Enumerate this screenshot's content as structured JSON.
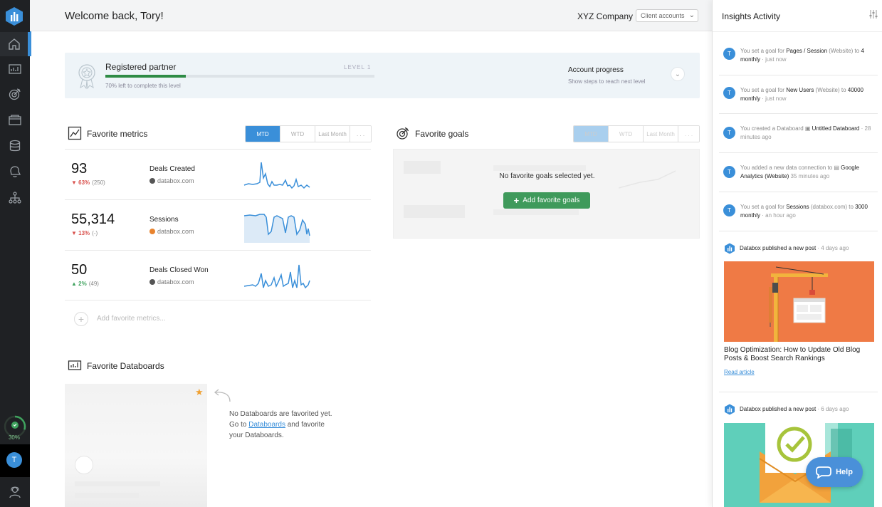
{
  "header": {
    "welcome": "Welcome back, Tory!",
    "company": "XYZ Company",
    "client_accounts": "Client accounts"
  },
  "sidebar": {
    "progress_label": "30%",
    "progress_value": 0.3,
    "avatar_initial": "T"
  },
  "partner": {
    "title": "Registered partner",
    "level": "LEVEL 1",
    "progress_text": "70% left to complete this level",
    "progress_value": 0.3,
    "account_progress_title": "Account progress",
    "account_progress_sub": "Show steps to reach next level"
  },
  "favorite_metrics": {
    "title": "Favorite metrics",
    "tabs": [
      "MTD",
      "WTD",
      "Last Month",
      ". . ."
    ],
    "active_tab": "MTD",
    "rows": [
      {
        "value": "93",
        "delta_dir": "down",
        "delta_arrow": "▼",
        "delta_pct": "63%",
        "delta_prev": "(250)",
        "name": "Deals Created",
        "source": "databox.com",
        "source_color": "#555555"
      },
      {
        "value": "55,314",
        "delta_dir": "down",
        "delta_arrow": "▼",
        "delta_pct": "13%",
        "delta_prev": "(-)",
        "name": "Sessions",
        "source": "databox.com",
        "source_color": "#e8832e"
      },
      {
        "value": "50",
        "delta_dir": "up",
        "delta_arrow": "▲",
        "delta_pct": "2%",
        "delta_prev": "(49)",
        "name": "Deals Closed Won",
        "source": "databox.com",
        "source_color": "#555555"
      }
    ],
    "add_label": "Add favorite metrics..."
  },
  "favorite_goals": {
    "title": "Favorite goals",
    "tabs": [
      "MTD",
      "WTD",
      "Last Month",
      ". . ."
    ],
    "active_tab": "MTD",
    "empty_text": "No favorite goals selected yet.",
    "add_button": "Add favorite goals"
  },
  "favorite_databoards": {
    "title": "Favorite Databoards",
    "msg_line1": "No Databoards are favorited yet.",
    "msg_go_to": "Go to ",
    "msg_link": "Databoards",
    "msg_after_link": " and favorite",
    "msg_line3": "your Databoards."
  },
  "insights": {
    "title": "Insights Activity",
    "items": [
      {
        "avatar": "T",
        "pre": "You set a goal for ",
        "bold": "Pages / Session",
        "mid": " (Website) to ",
        "bold2": "4 monthly",
        "time": " · just now"
      },
      {
        "avatar": "T",
        "pre": "You set a goal for ",
        "bold": "New Users",
        "mid": " (Website) to ",
        "bold2": "40000 monthly",
        "time": " · just now"
      },
      {
        "avatar": "T",
        "pre": "You created a Databoard ",
        "bold": "Untitled Databoard",
        "mid": "",
        "bold2": "",
        "time": " · 28 minutes ago"
      },
      {
        "avatar": "T",
        "pre": "You added a new data connection to ",
        "bold": "Google Analytics (Website)",
        "mid": "",
        "bold2": "",
        "time": " 35 minutes ago"
      },
      {
        "avatar": "T",
        "pre": "You set a goal for ",
        "bold": "Sessions",
        "mid": " (databox.com) to ",
        "bold2": "3000 monthly",
        "time": " · an hour ago"
      }
    ],
    "posts": [
      {
        "author": "Databox published a new post",
        "time": " · 4 days ago",
        "title": "Blog Optimization: How to Update Old Blog Posts & Boost Search Rankings",
        "read": "Read article"
      },
      {
        "author": "Databox published a new post",
        "time": " · 6 days ago"
      }
    ]
  },
  "help_label": "Help",
  "colors": {
    "accent": "#3a8fd9",
    "success": "#3f9a5b",
    "danger": "#d9534f",
    "sidebar": "#1f2124"
  }
}
